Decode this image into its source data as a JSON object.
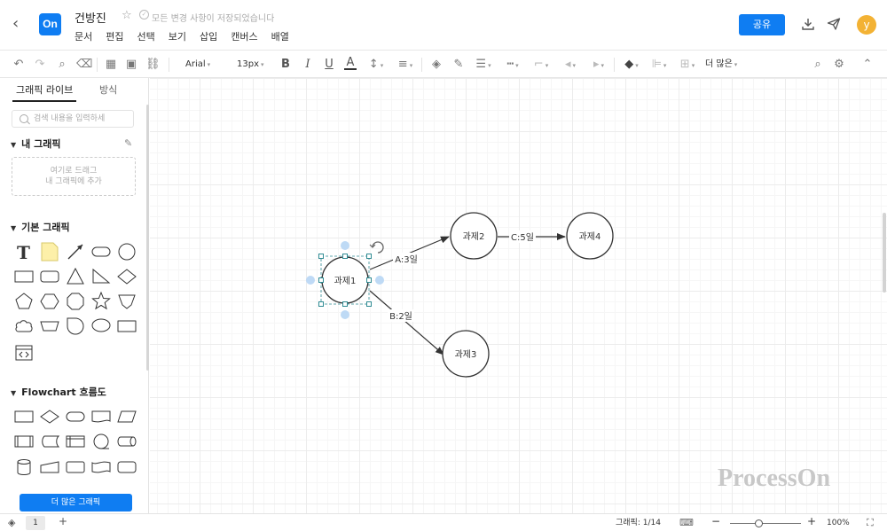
{
  "header": {
    "title": "건방진",
    "save_status": "모든 변경 사항이 저장되었습니다",
    "logo_text": "On",
    "menu": [
      "문서",
      "편집",
      "선택",
      "보기",
      "삽입",
      "캔버스",
      "배열"
    ],
    "share_label": "공유",
    "avatar_letter": "y"
  },
  "toolbar": {
    "font": "Arial",
    "font_size": "13px",
    "more_label": "더 많은"
  },
  "sidebar": {
    "tabs": [
      "그래픽 라이브",
      "방식"
    ],
    "search_placeholder": "검색 내용을 입력하세",
    "my_graphics_title": "내 그래픽",
    "drop_hint_line1": "여기로 드래그",
    "drop_hint_line2": "내 그래픽에 추가",
    "basic_title": "기본 그래픽",
    "flowchart_title": "Flowchart 흐름도",
    "more_button": "더 많은 그래픽"
  },
  "diagram": {
    "nodes": [
      {
        "id": "n1",
        "label": "과제1",
        "selected": true
      },
      {
        "id": "n2",
        "label": "과제2"
      },
      {
        "id": "n3",
        "label": "과제3"
      },
      {
        "id": "n4",
        "label": "과제4"
      }
    ],
    "edges": [
      {
        "from": "n1",
        "to": "n2",
        "label": "A:3일"
      },
      {
        "from": "n1",
        "to": "n3",
        "label": "B:2일"
      },
      {
        "from": "n2",
        "to": "n4",
        "label": "C:5일"
      }
    ]
  },
  "watermark": "ProcessOn",
  "statusbar": {
    "page": "1",
    "graphics_count": "그래픽: 1/14",
    "zoom": "100%"
  },
  "colors": {
    "accent": "#0f7df2",
    "selection": "#2f8b93",
    "avatar": "#f3b234"
  }
}
